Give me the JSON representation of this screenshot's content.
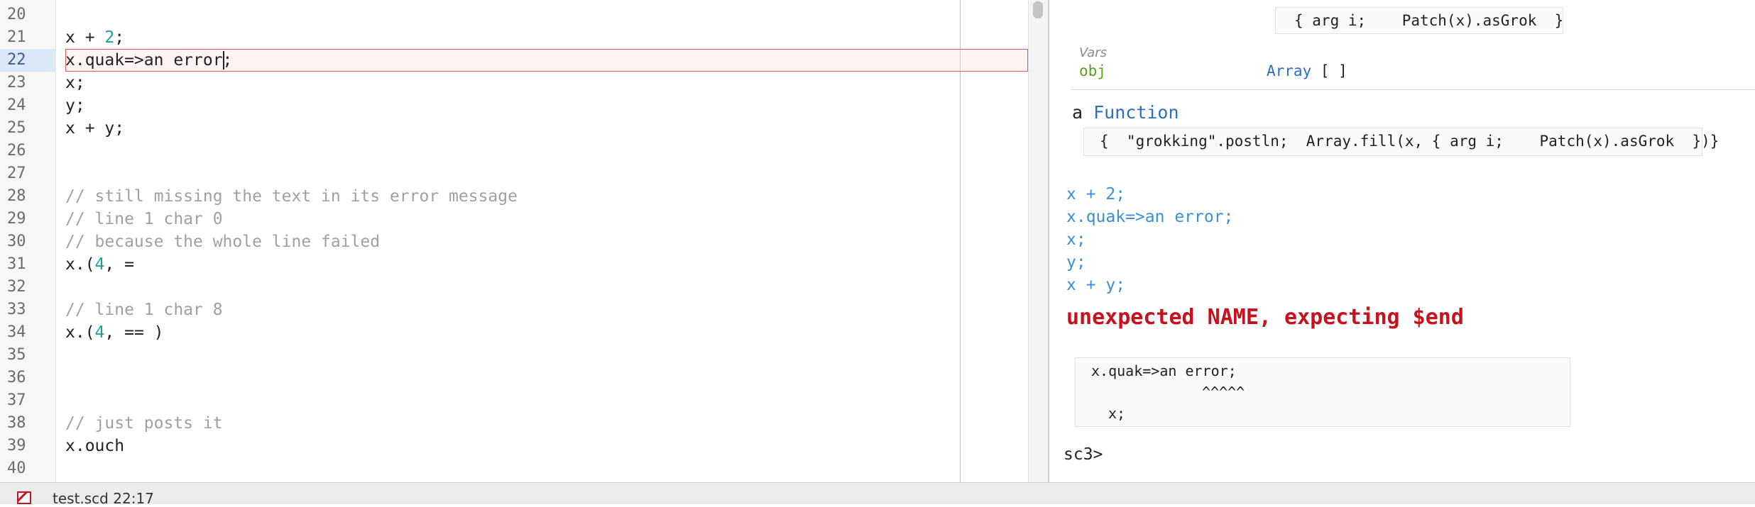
{
  "editor": {
    "lines": [
      {
        "no": "20",
        "text": ""
      },
      {
        "no": "21",
        "pre": "x + ",
        "num": "2",
        "post": ";"
      },
      {
        "no": "22",
        "text": "x.quak=>an error;",
        "active": true,
        "error": true
      },
      {
        "no": "23",
        "text": "x;"
      },
      {
        "no": "24",
        "text": "y;"
      },
      {
        "no": "25",
        "text": "x + y;"
      },
      {
        "no": "26",
        "text": ""
      },
      {
        "no": "27",
        "text": ""
      },
      {
        "no": "28",
        "text": "// still missing the text in its error message",
        "comment": true
      },
      {
        "no": "29",
        "text": "// line 1 char 0",
        "comment": true
      },
      {
        "no": "30",
        "text": "// because the whole line failed",
        "comment": true
      },
      {
        "no": "31",
        "pre": "x.(",
        "num": "4",
        "post": ", ="
      },
      {
        "no": "32",
        "text": ""
      },
      {
        "no": "33",
        "text": "// line 1 char 8",
        "comment": true
      },
      {
        "no": "34",
        "pre": "x.(",
        "num": "4",
        "post": ", == )"
      },
      {
        "no": "35",
        "text": ""
      },
      {
        "no": "36",
        "text": ""
      },
      {
        "no": "37",
        "text": ""
      },
      {
        "no": "38",
        "text": "// just posts it",
        "comment": true
      },
      {
        "no": "39",
        "text": "x.ouch"
      },
      {
        "no": "40",
        "text": ""
      }
    ]
  },
  "post_window": {
    "top_code": "{ arg i;    Patch(x).asGrok  }",
    "vars": {
      "title": "Vars",
      "name": "obj",
      "value_class": "Array",
      "value_rest": " [ ]"
    },
    "function": {
      "prefix": "a ",
      "class": "Function",
      "code": "{  \"grokking\".postln;  Array.fill(x, { arg i;    Patch(x).asGrok  })}"
    },
    "echo_lines": [
      "x + 2;",
      "x.quak=>an error;",
      "x;",
      "y;",
      "x + y;"
    ],
    "error_message": "unexpected NAME, expecting $end",
    "error_context": {
      "line": "x.quak=>an error;",
      "marker": "^^^^^",
      "next": "x;"
    },
    "prompt": "sc3>"
  },
  "status_bar": {
    "document": "test.scd",
    "position": "22:17"
  },
  "colors": {
    "number": "#1aa19c",
    "comment": "#a0a0a0",
    "echo": "#3c8fd4",
    "error": "#c8111d",
    "class": "#2a6fbf",
    "var_name": "#5e9b1e"
  }
}
